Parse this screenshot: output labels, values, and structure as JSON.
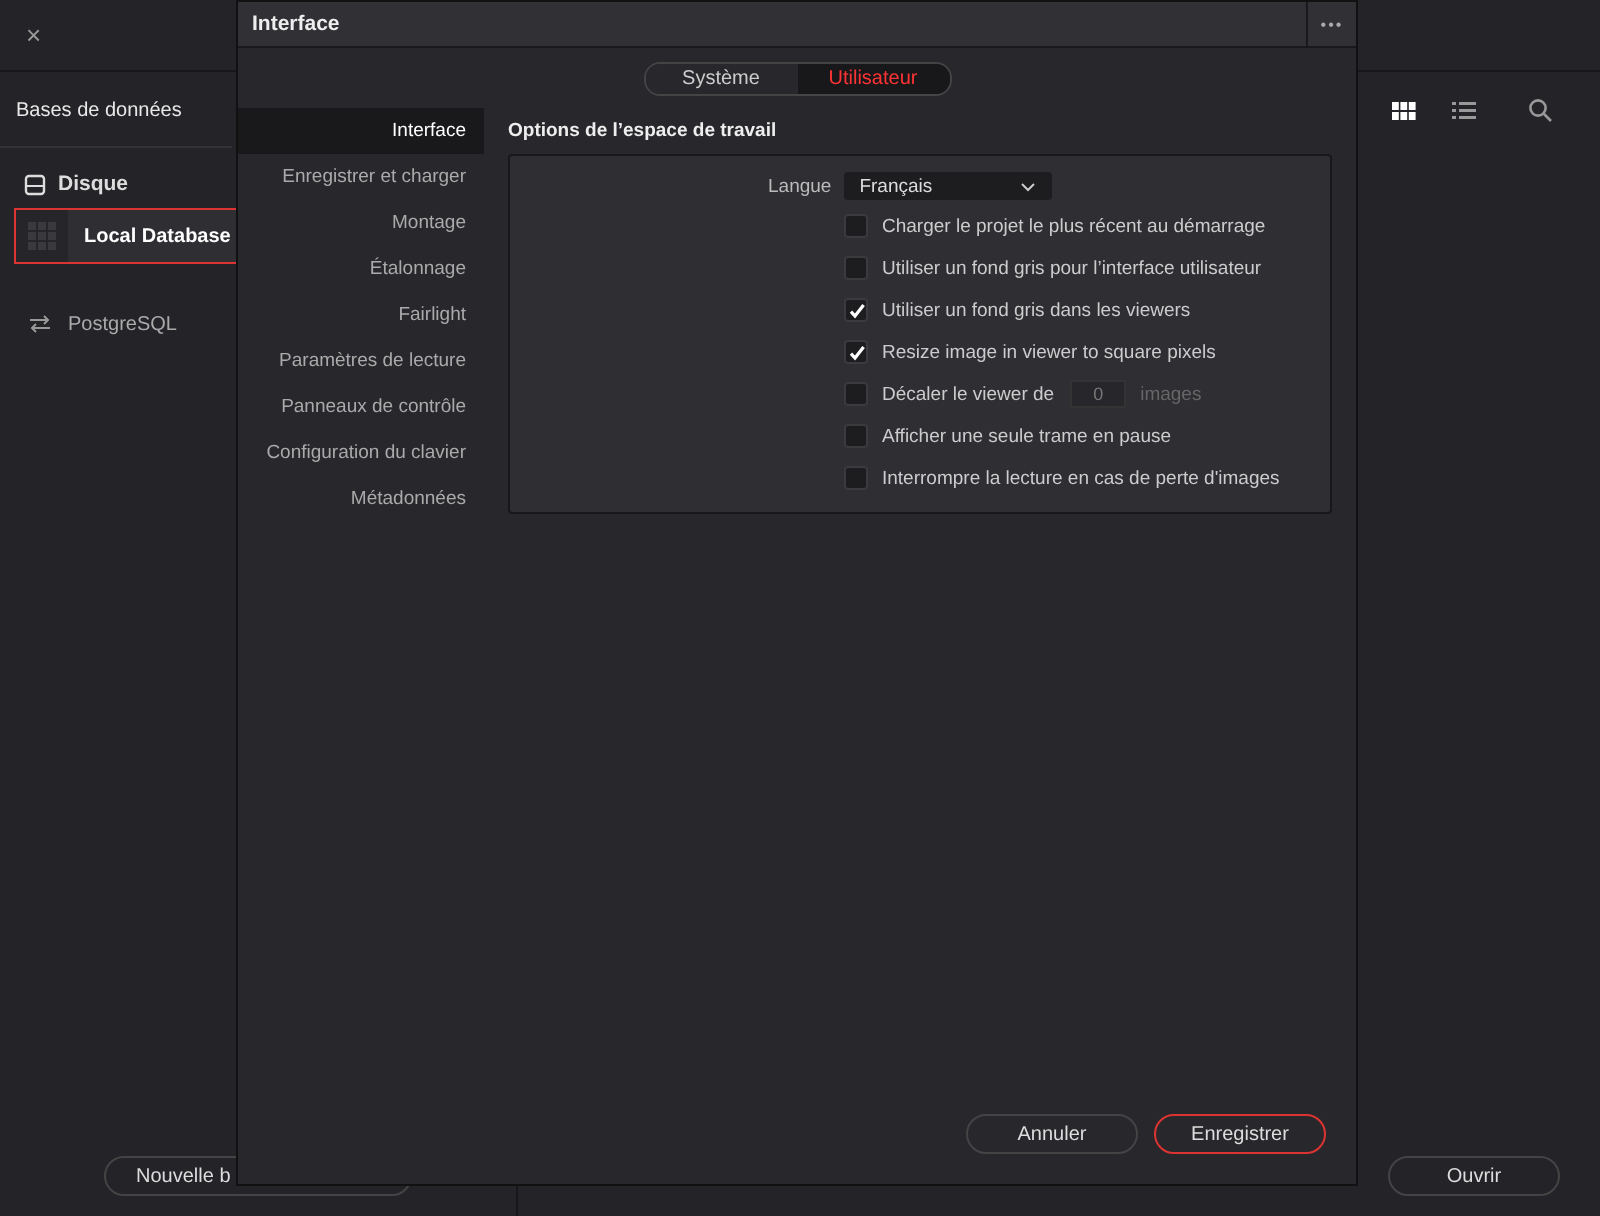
{
  "background": {
    "close": "×",
    "sidebar_title": "Bases de données",
    "group": {
      "label": "Disque"
    },
    "databases": [
      {
        "label": "Local Database",
        "kind": "local",
        "selected": true
      },
      {
        "label": "PostgreSQL",
        "kind": "remote",
        "selected": false
      }
    ],
    "view_modes": [
      {
        "kind": "grid",
        "selected": true
      },
      {
        "kind": "list",
        "selected": false
      }
    ],
    "new_button": "Nouvelle b",
    "open_button": "Ouvrir"
  },
  "dialog": {
    "title": "Interface",
    "menu": "•••",
    "tabs": [
      {
        "label": "Système",
        "selected": false
      },
      {
        "label": "Utilisateur",
        "selected": true
      }
    ],
    "nav": [
      {
        "label": "Interface",
        "selected": true
      },
      {
        "label": "Enregistrer et charger",
        "selected": false
      },
      {
        "label": "Montage",
        "selected": false
      },
      {
        "label": "Étalonnage",
        "selected": false
      },
      {
        "label": "Fairlight",
        "selected": false
      },
      {
        "label": "Paramètres de lecture",
        "selected": false
      },
      {
        "label": "Panneaux de contrôle",
        "selected": false
      },
      {
        "label": "Configuration du clavier",
        "selected": false
      },
      {
        "label": "Métadonnées",
        "selected": false
      }
    ],
    "section_title": "Options de l’espace de travail",
    "language": {
      "label": "Langue",
      "value": "Français"
    },
    "options": [
      {
        "label": "Charger le projet le plus récent au démarrage",
        "checked": false
      },
      {
        "label": "Utiliser un fond gris pour l’interface utilisateur",
        "checked": false
      },
      {
        "label": "Utiliser un fond gris dans les viewers",
        "checked": true
      },
      {
        "label": "Resize image in viewer to square pixels",
        "checked": true
      },
      {
        "label": "Décaler le viewer de",
        "checked": false,
        "field": {
          "value": "0",
          "unit": "images",
          "disabled": true
        }
      },
      {
        "label": "Afficher une seule trame en pause",
        "checked": false
      },
      {
        "label": "Interrompre la lecture en cas de perte d'images",
        "checked": false
      }
    ],
    "buttons": [
      {
        "label": "Annuler",
        "primary": false
      },
      {
        "label": "Enregistrer",
        "primary": true
      }
    ]
  }
}
